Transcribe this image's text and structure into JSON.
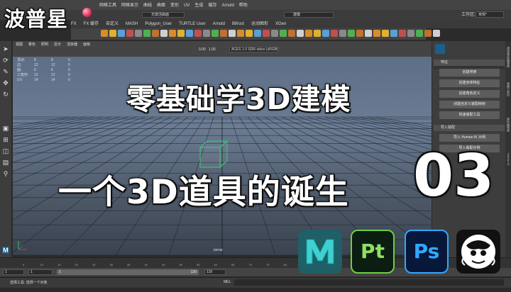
{
  "brand": {
    "logo_text": "波普星"
  },
  "menubar": {
    "items": [
      "网格工具",
      "网格显示",
      "曲线",
      "曲面",
      "变形",
      "UV",
      "生成",
      "缓存",
      "Arnold",
      "帮助"
    ]
  },
  "statusline": {
    "mode": "建模",
    "live_surface": "无激活曲面",
    "workspace_label": "工作区:",
    "workspace_value": "常规*"
  },
  "shelf_tabs": [
    "FX",
    "FX 缓存",
    "自定义",
    "MASH",
    "Polygon_User",
    "TURTLE User",
    "Arnold",
    "Bifrost",
    "运动图形",
    "XGen"
  ],
  "viewport": {
    "menu": [
      "视图",
      "着色",
      "照明",
      "显示",
      "渲染器",
      "面板"
    ],
    "gamma": "0.00",
    "exposure": "1.00",
    "colorspace": "ACES 1.0 SDR-video (sRGB)",
    "camera_label": "persp",
    "hud": {
      "rows": [
        {
          "label": "顶点:",
          "values": [
            "8",
            "8",
            "0"
          ]
        },
        {
          "label": "边:",
          "values": [
            "12",
            "12",
            "0"
          ]
        },
        {
          "label": "面:",
          "values": [
            "6",
            "6",
            "0"
          ]
        },
        {
          "label": "三角形:",
          "values": [
            "12",
            "12",
            "0"
          ]
        },
        {
          "label": "UV:",
          "values": [
            "14",
            "14",
            "0"
          ]
        }
      ]
    }
  },
  "right_panel": {
    "sections": [
      {
        "label": "特征",
        "buttons": [
          "创建骨架",
          "创建身体特征",
          "创建角色定义",
          "创建自定义装配映射",
          "快速装配工具"
        ]
      },
      {
        "label": "导入装配",
        "buttons": [
          "导入 Human IK 示例",
          "导入装配示例"
        ]
      }
    ],
    "vertical_tabs": [
      "通道盒/层编辑器",
      "建模工具包",
      "属性编辑器",
      "Human IK"
    ]
  },
  "timeline": {
    "ticks": [
      "5",
      "10",
      "15",
      "20",
      "25",
      "30",
      "35",
      "40",
      "45",
      "50",
      "55",
      "60",
      "65",
      "70",
      "75",
      "80",
      "85",
      "90",
      "95",
      "100",
      "105",
      "110",
      "115",
      "120"
    ],
    "start": "1",
    "start_inner": "1",
    "end_inner": "120",
    "end": "120"
  },
  "commandline": {
    "mel_label": "MEL",
    "help_text": "选择工具: 选择一个对象"
  },
  "overlay": {
    "title": "零基础学3D建模",
    "subtitle": "一个3D道具的诞生",
    "episode": "03"
  },
  "app_logos": [
    {
      "name": "maya-logo-icon",
      "text": "M"
    },
    {
      "name": "substance-painter-logo-icon",
      "text": "Pt"
    },
    {
      "name": "photoshop-logo-icon",
      "text": "Ps"
    },
    {
      "name": "zbrush-logo-icon",
      "text": ""
    }
  ],
  "colors": {
    "viewport_top": "#5d6e87",
    "viewport_bottom": "#3a434f",
    "cube_edge": "#3dbb7a",
    "maya_teal": "#1f5f66",
    "pt_green": "#6fcf3f",
    "ps_blue": "#31a8ff"
  }
}
